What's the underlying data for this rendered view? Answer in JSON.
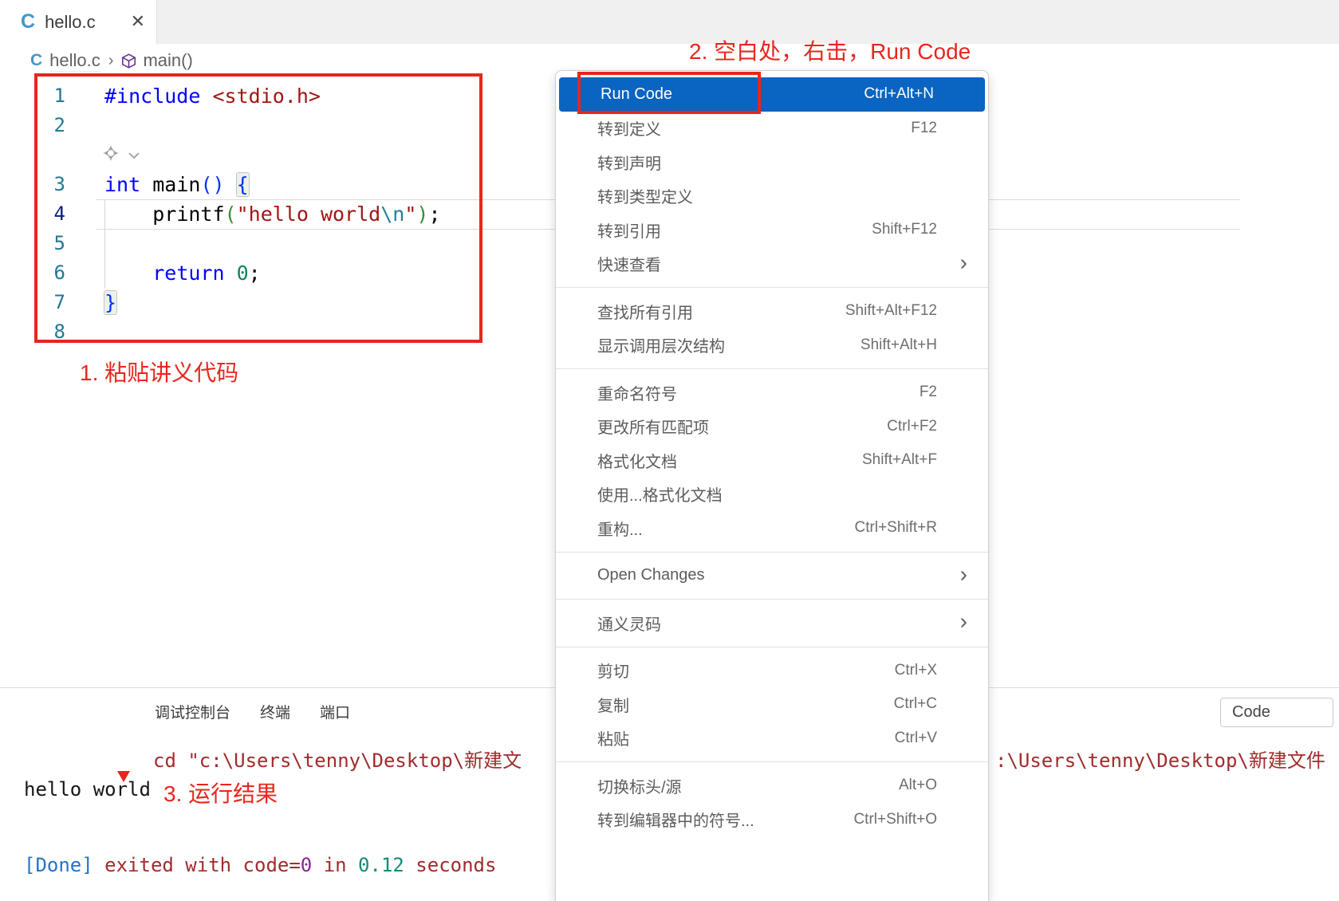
{
  "tab": {
    "file_icon": "C",
    "title": "hello.c",
    "close": "✕"
  },
  "breadcrumb": {
    "file_icon": "C",
    "file": "hello.c",
    "separator": "›",
    "symbol": "main()"
  },
  "annotations": {
    "step1": "1. 粘贴讲义代码",
    "step2": "2. 空白处，右击，Run Code",
    "step3": "3. 运行结果"
  },
  "editor": {
    "lines": [
      {
        "num": "1",
        "tokens": [
          [
            "#include",
            "kw"
          ],
          [
            " ",
            "pl"
          ],
          [
            "<stdio.h>",
            "str"
          ]
        ]
      },
      {
        "num": "2",
        "tokens": []
      },
      {
        "num": "",
        "icons": [
          "sparkle-icon",
          "chevron-down-icon"
        ],
        "tokens": []
      },
      {
        "num": "3",
        "tokens": [
          [
            "int",
            "kw"
          ],
          [
            " ",
            "pl"
          ],
          [
            "main",
            "fn"
          ],
          [
            "(",
            "b1"
          ],
          [
            ")",
            "b1"
          ],
          [
            " ",
            "pl"
          ],
          [
            "{",
            "b1m"
          ]
        ]
      },
      {
        "num": "4",
        "current": true,
        "tokens": [
          [
            "    ",
            "pl"
          ],
          [
            "printf",
            "fn"
          ],
          [
            "(",
            "b2"
          ],
          [
            "\"hello world",
            "str"
          ],
          [
            "\\n",
            "esc"
          ],
          [
            "\"",
            "str"
          ],
          [
            ")",
            "b2"
          ],
          [
            ";",
            "pl"
          ]
        ]
      },
      {
        "num": "5",
        "tokens": []
      },
      {
        "num": "6",
        "tokens": [
          [
            "    ",
            "pl"
          ],
          [
            "return",
            "kw"
          ],
          [
            " ",
            "pl"
          ],
          [
            "0",
            "num"
          ],
          [
            ";",
            "pl"
          ]
        ]
      },
      {
        "num": "7",
        "tokens": [
          [
            "}",
            "b1m"
          ]
        ]
      },
      {
        "num": "8",
        "tokens": []
      }
    ]
  },
  "context_menu": {
    "sections": [
      {
        "items": [
          {
            "label": "Run Code",
            "shortcut": "Ctrl+Alt+N",
            "selected": true
          },
          {
            "label": "转到定义",
            "shortcut": "F12"
          },
          {
            "label": "转到声明",
            "shortcut": ""
          },
          {
            "label": "转到类型定义",
            "shortcut": ""
          },
          {
            "label": "转到引用",
            "shortcut": "Shift+F12"
          },
          {
            "label": "快速查看",
            "shortcut": "",
            "submenu": true
          }
        ]
      },
      {
        "items": [
          {
            "label": "查找所有引用",
            "shortcut": "Shift+Alt+F12"
          },
          {
            "label": "显示调用层次结构",
            "shortcut": "Shift+Alt+H"
          }
        ]
      },
      {
        "items": [
          {
            "label": "重命名符号",
            "shortcut": "F2"
          },
          {
            "label": "更改所有匹配项",
            "shortcut": "Ctrl+F2"
          },
          {
            "label": "格式化文档",
            "shortcut": "Shift+Alt+F"
          },
          {
            "label": "使用...格式化文档",
            "shortcut": ""
          },
          {
            "label": "重构...",
            "shortcut": "Ctrl+Shift+R"
          }
        ]
      },
      {
        "items": [
          {
            "label": "Open Changes",
            "shortcut": "",
            "submenu": true
          }
        ]
      },
      {
        "items": [
          {
            "label": "通义灵码",
            "shortcut": "",
            "submenu": true
          }
        ]
      },
      {
        "items": [
          {
            "label": "剪切",
            "shortcut": "Ctrl+X"
          },
          {
            "label": "复制",
            "shortcut": "Ctrl+C"
          },
          {
            "label": "粘贴",
            "shortcut": "Ctrl+V"
          }
        ]
      },
      {
        "items": [
          {
            "label": "切换标头/源",
            "shortcut": "Alt+O"
          },
          {
            "label": "转到编辑器中的符号...",
            "shortcut": "Ctrl+Shift+O"
          }
        ]
      }
    ],
    "submenu_chevron": "›"
  },
  "panel": {
    "tabs": [
      "调试控制台",
      "终端",
      "端口"
    ],
    "output_selector": "Code",
    "terminal": {
      "cmd_left": "cd \"c:\\Users\\tenny\\Desktop\\新建文",
      "cmd_right": ":\\Users\\tenny\\Desktop\\新建文件",
      "stdout": "hello world",
      "done_line": [
        [
          "[Done]",
          "blue"
        ],
        [
          " exited with code=",
          "red"
        ],
        [
          "0",
          "magenta"
        ],
        [
          " in ",
          "red"
        ],
        [
          "0.12",
          "cyan"
        ],
        [
          " seconds",
          "red"
        ]
      ]
    }
  },
  "colors": {
    "annotation_red": "#e7261d",
    "menu_selection_blue": "#0a64c1",
    "keyword_blue": "#0000ff",
    "string_red": "#a31515",
    "line_number_teal": "#237893"
  }
}
